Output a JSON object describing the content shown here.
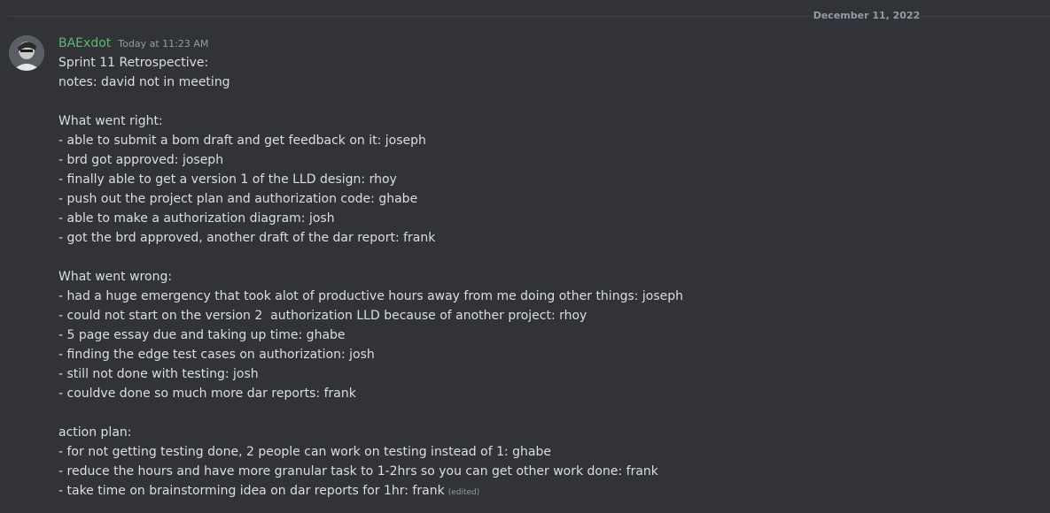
{
  "divider": {
    "date": "December 11, 2022"
  },
  "message": {
    "author": "BAExdot",
    "timestamp": "Today at 11:23 AM",
    "edited_label": "(edited)",
    "lines": [
      "Sprint 11 Retrospective:",
      "notes: david not in meeting",
      "",
      "What went right:",
      "- able to submit a bom draft and get feedback on it: joseph",
      "- brd got approved: joseph",
      "- finally able to get a version 1 of the LLD design: rhoy",
      "- push out the project plan and authorization code: ghabe",
      "- able to make a authorization diagram: josh",
      "- got the brd approved, another draft of the dar report: frank",
      "",
      "What went wrong:",
      "- had a huge emergency that took alot of productive hours away from me doing other things: joseph",
      "- could not start on the version 2  authorization LLD because of another project: rhoy",
      "- 5 page essay due and taking up time: ghabe",
      "- finding the edge test cases on authorization: josh",
      "- still not done with testing: josh",
      "- couldve done so much more dar reports: frank",
      "",
      "action plan:",
      "- for not getting testing done, 2 people can work on testing instead of 1: ghabe",
      "- reduce the hours and have more granular task to 1-2hrs so you can get other work done: frank",
      "- take time on brainstorming idea on dar reports for 1hr: frank"
    ]
  }
}
